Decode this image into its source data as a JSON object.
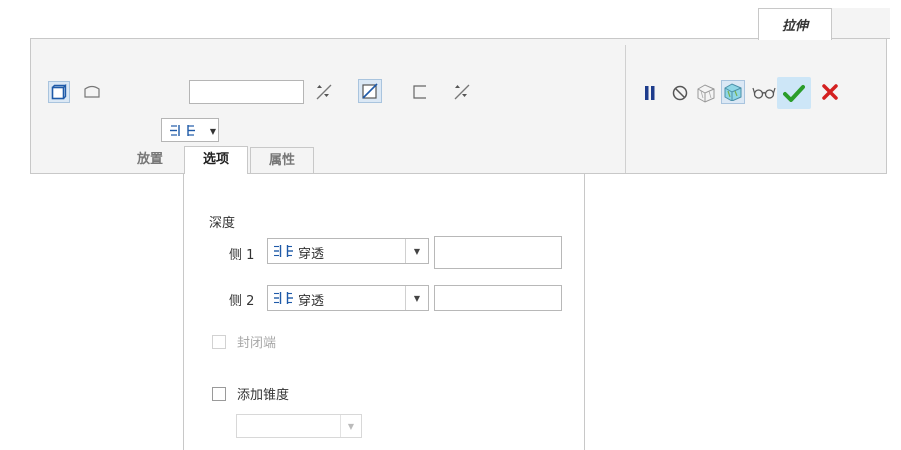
{
  "top_tab": {
    "label": "拉伸"
  },
  "dashboard": {
    "depth_value": "",
    "subtabs": [
      {
        "label": "放置"
      },
      {
        "label": "选项"
      },
      {
        "label": "属性"
      }
    ]
  },
  "options": {
    "depth_heading": "深度",
    "side1": {
      "label": "侧 1",
      "value": "穿透",
      "input": ""
    },
    "side2": {
      "label": "侧 2",
      "value": "穿透",
      "input": ""
    },
    "capped_ends": "封闭端",
    "add_taper": "添加锥度",
    "taper_value": ""
  },
  "colors": {
    "accent_blue": "#1f5aa8",
    "pause_blue": "#1e3c8c",
    "ok_green": "#2a9d2a",
    "ok_bg": "#cde6f7",
    "cancel_red": "#d42020"
  },
  "icons": [
    "solid-icon",
    "surface-icon",
    "depth-blind-icon",
    "flip-direction-icon",
    "remove-material-icon",
    "thicken-icon",
    "pause-icon",
    "no-preview-icon",
    "geometry-preview-icon",
    "feature-preview-icon",
    "verify-glasses-icon",
    "checkmark-icon",
    "cancel-icon"
  ]
}
